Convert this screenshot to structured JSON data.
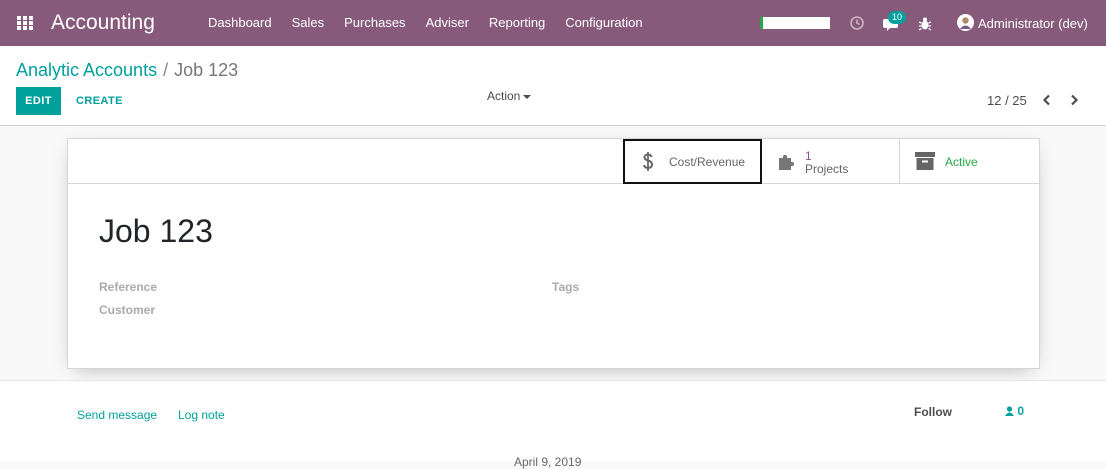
{
  "navbar": {
    "app_title": "Accounting",
    "menu": [
      "Dashboard",
      "Sales",
      "Purchases",
      "Adviser",
      "Reporting",
      "Configuration"
    ],
    "progress_fraction": 0.04,
    "progress_color": "#28a745",
    "icons": [
      "apps-icon",
      "clock-icon",
      "chat-icon",
      "bug-icon"
    ],
    "chat_badge": "10",
    "user_name": "Administrator (dev)",
    "bar_color": "#875a7b"
  },
  "control_panel": {
    "breadcrumb_parent": "Analytic Accounts",
    "breadcrumb_separator": "/",
    "breadcrumb_current": "Job 123",
    "edit_label": "EDIT",
    "create_label": "CREATE",
    "action_label": "Action",
    "pager": "12 / 25",
    "accent_color": "#00a09d"
  },
  "sheet": {
    "stat_cost_label": "Cost/Revenue",
    "stat_projects_count": "1",
    "stat_projects_label": "Projects",
    "stat_active_label": "Active",
    "record_name": "Job 123",
    "field_reference_label": "Reference",
    "field_customer_label": "Customer",
    "field_tags_label": "Tags"
  },
  "chatter": {
    "send_message_label": "Send message",
    "log_note_label": "Log note",
    "follow_label": "Follow",
    "followers_count": "0",
    "date_separator": "April 9, 2019"
  }
}
